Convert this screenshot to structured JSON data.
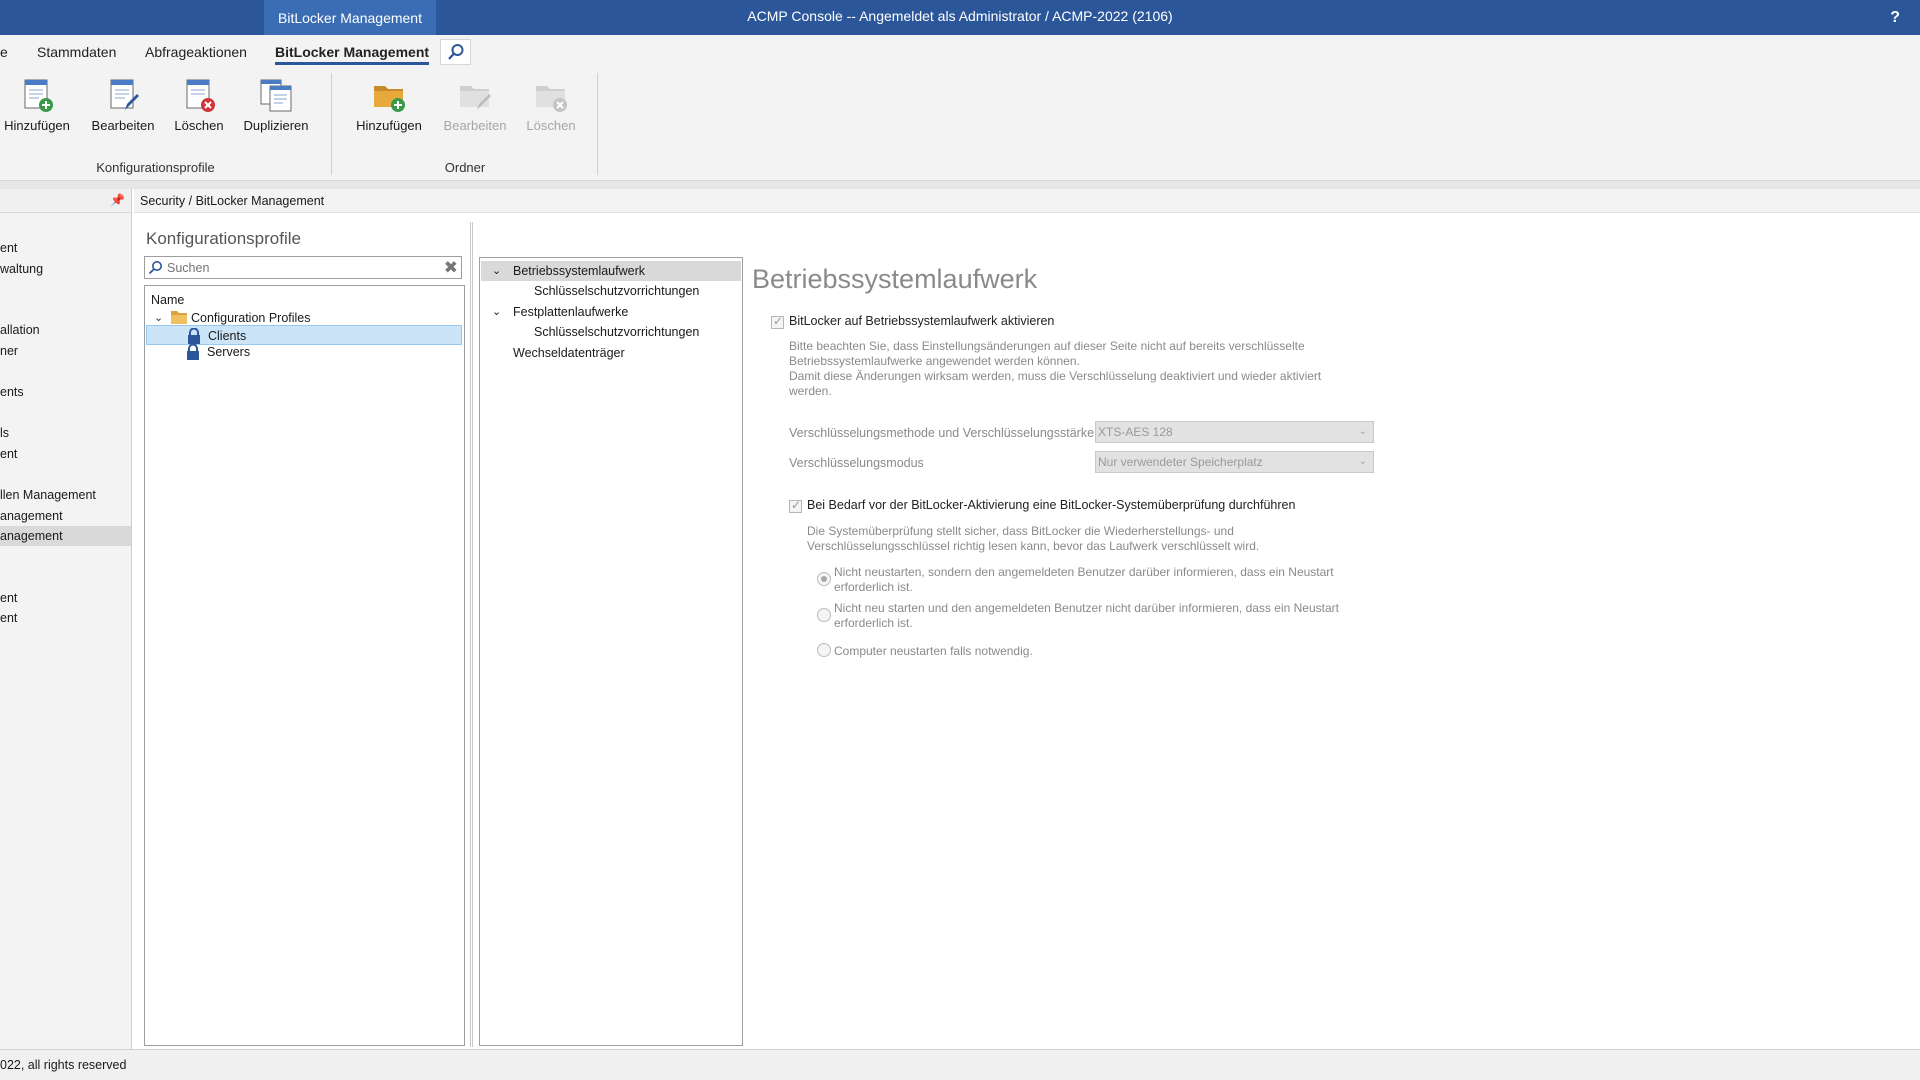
{
  "window": {
    "context_tab": "BitLocker Management",
    "title": "ACMP Console -- Angemeldet als Administrator / ACMP-2022 (2106)",
    "help": "?"
  },
  "ribbon_tabs": [
    "e",
    "Stammdaten",
    "Abfrageaktionen",
    "BitLocker Management"
  ],
  "ribbon": {
    "profiles_group": {
      "label": "Konfigurationsprofile",
      "buttons": [
        "Hinzufügen",
        "Bearbeiten",
        "Löschen",
        "Duplizieren"
      ]
    },
    "folder_group": {
      "label": "Ordner",
      "buttons": [
        "Hinzufügen",
        "Bearbeiten",
        "Löschen"
      ]
    }
  },
  "nav": {
    "items": [
      "ent",
      "waltung",
      "allation",
      "ner",
      "ents",
      "ls",
      "ent",
      "llen Management",
      "anagement",
      "anagement",
      "ent",
      "ent"
    ],
    "selected_index": 9
  },
  "breadcrumb": "Security / BitLocker Management",
  "profiles": {
    "title": "Konfigurationsprofile",
    "search_placeholder": "Suchen",
    "column_header": "Name",
    "root": "Configuration Profiles",
    "children": [
      "Clients",
      "Servers"
    ],
    "selected": "Clients"
  },
  "settings_tree": {
    "items": [
      {
        "label": "Betriebssystemlaufwerk",
        "level": 0,
        "expanded": true
      },
      {
        "label": "Schlüsselschutzvorrichtungen",
        "level": 1
      },
      {
        "label": "Festplattenlaufwerke",
        "level": 0,
        "expanded": true
      },
      {
        "label": "Schlüsselschutzvorrichtungen",
        "level": 1
      },
      {
        "label": "Wechseldatenträger",
        "level": 0
      }
    ],
    "selected_index": 0
  },
  "detail": {
    "title": "Betriebssystemlaufwerk",
    "enable_checkbox": "BitLocker auf Betriebssystemlaufwerk aktivieren",
    "enable_note": [
      "Bitte beachten Sie, dass Einstellungsänderungen auf dieser Seite nicht auf bereits verschlüsselte",
      "Betriebssystemlaufwerke angewendet werden können.",
      "Damit diese Änderungen wirksam werden, muss die Verschlüsselung deaktiviert und wieder aktiviert",
      "werden."
    ],
    "method_label": "Verschlüsselungsmethode und Verschlüsselungsstärke",
    "method_value": "XTS-AES 128",
    "mode_label": "Verschlüsselungsmodus",
    "mode_value": "Nur verwendeter Speicherplatz",
    "check_checkbox": "Bei Bedarf vor der BitLocker-Aktivierung eine BitLocker-Systemüberprüfung durchführen",
    "check_note": [
      "Die Systemüberprüfung stellt sicher, dass BitLocker die Wiederherstellungs- und",
      "Verschlüsselungsschlüssel richtig lesen kann, bevor das Laufwerk verschlüsselt wird."
    ],
    "radio_options": [
      [
        "Nicht neustarten, sondern den angemeldeten Benutzer darüber informieren, dass ein Neustart",
        "erforderlich ist."
      ],
      [
        "Nicht neu starten und den angemeldeten Benutzer nicht darüber informieren, dass ein Neustart",
        "erforderlich ist."
      ],
      [
        "Computer neustarten falls notwendig."
      ]
    ],
    "radio_selected": 0
  },
  "statusbar": "022, all rights reserved"
}
